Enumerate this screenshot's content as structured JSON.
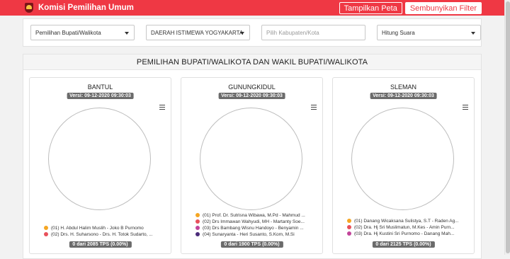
{
  "app": {
    "title": "Komisi Pemilihan Umum"
  },
  "header": {
    "show_map_label": "Tampilkan Peta",
    "hide_filter_label": "Sembunyikan Filter"
  },
  "filters": {
    "election_type": "Pemilihan Bupati/Walikota",
    "province": "DAERAH ISTIMEWA YOGYAKARTA",
    "regency_placeholder": "Pilih Kabupaten/Kota",
    "mode": "Hitung Suara"
  },
  "main": {
    "title": "PEMILIHAN BUPATI/WALIKOTA DAN WAKIL BUPATI/WALIKOTA"
  },
  "colors": {
    "brand": "#ef3844",
    "c01": "#f5a623",
    "c02": "#e8505b",
    "c03": "#c2449a",
    "c04": "#4b2c7a"
  },
  "cards": [
    {
      "title": "BANTUL",
      "version": "Versi: 09-12-2020 09:30:03",
      "legend": [
        {
          "label": "(01) H. Abdul Halim Muslih - Joko B Purnomo",
          "color": "#f5a623"
        },
        {
          "label": "(02) Drs. H. Suharsono - Drs. H. Totok Sudarto, ...",
          "color": "#e8505b"
        }
      ],
      "tps": "0 dari 2085 TPS (0.00%)"
    },
    {
      "title": "GUNUNGKIDUL",
      "version": "Versi: 09-12-2020 09:30:03",
      "legend": [
        {
          "label": "(01) Prof. Dr. Sutrisna Wibawa, M.Pd - Mahmud ...",
          "color": "#f5a623"
        },
        {
          "label": "(02) Drs Immawan Wahyudi, MH - Martanty Soe...",
          "color": "#e8505b"
        },
        {
          "label": "(03) Drs Bambang Wisnu Handoyo - Benyamin ...",
          "color": "#c2449a"
        },
        {
          "label": "(04) Sunaryanta - Heri Susanto, S.Kom, M.Si",
          "color": "#4b2c7a"
        }
      ],
      "tps": "0 dari 1900 TPS (0.00%)"
    },
    {
      "title": "SLEMAN",
      "version": "Versi: 09-12-2020 09:30:03",
      "legend": [
        {
          "label": "(01) Danang Wicaksana Sulistya, S.T - Raden Ag...",
          "color": "#f5a623"
        },
        {
          "label": "(02) Dra. Hj Sri Muslimatun, M.Kes - Amin Purn...",
          "color": "#e8505b"
        },
        {
          "label": "(03) Dra. Hj Kustini Sri Purnomo - Danang Mah...",
          "color": "#c2449a"
        }
      ],
      "tps": "0 dari 2125 TPS (0.00%)"
    }
  ]
}
